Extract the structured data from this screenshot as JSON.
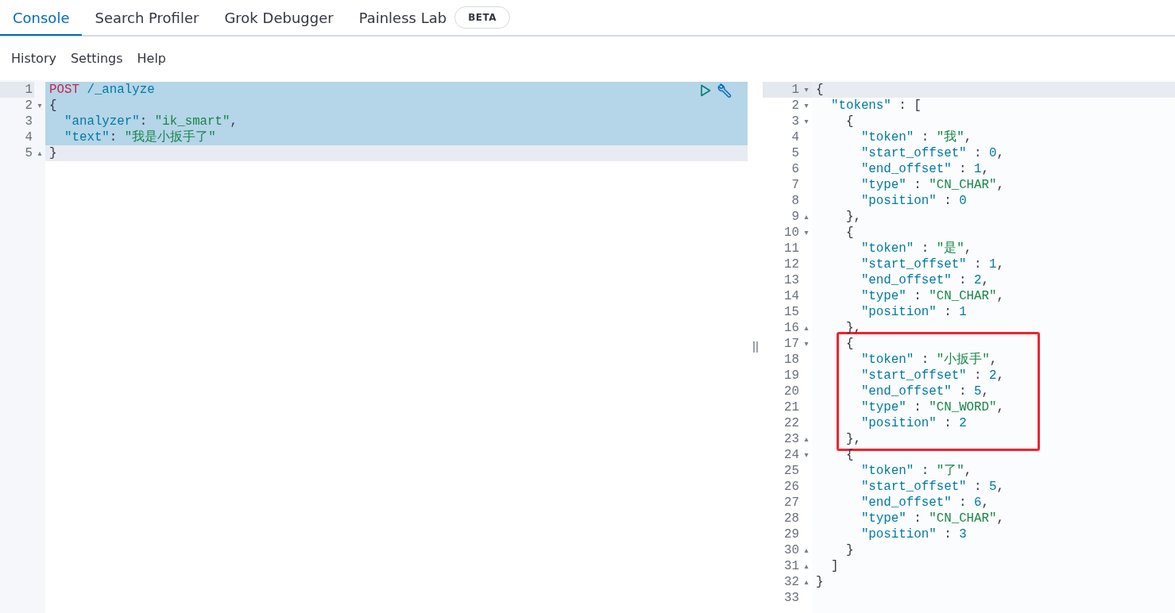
{
  "tabs": [
    {
      "label": "Console",
      "selected": true
    },
    {
      "label": "Search Profiler",
      "selected": false
    },
    {
      "label": "Grok Debugger",
      "selected": false
    },
    {
      "label": "Painless Lab",
      "selected": false,
      "badge": "BETA"
    }
  ],
  "menu": [
    "History",
    "Settings",
    "Help"
  ],
  "request": {
    "lines": [
      {
        "number": "1",
        "selected": true,
        "current": false,
        "gutter_highlight": true,
        "tokens": [
          {
            "kind": "method",
            "text": "POST"
          },
          {
            "kind": "url",
            "text": " /_analyze"
          }
        ]
      },
      {
        "number": "2",
        "fold": "▾",
        "selected": true,
        "current": false,
        "gutter_highlight": false,
        "tokens": [
          {
            "kind": "punct",
            "text": "{"
          }
        ]
      },
      {
        "number": "3",
        "selected": true,
        "current": false,
        "gutter_highlight": false,
        "tokens": [
          {
            "kind": "key",
            "text": "  \"analyzer\""
          },
          {
            "kind": "punct",
            "text": ": "
          },
          {
            "kind": "string",
            "text": "\"ik_smart\""
          },
          {
            "kind": "punct",
            "text": ","
          }
        ]
      },
      {
        "number": "4",
        "selected": true,
        "current": false,
        "gutter_highlight": false,
        "tokens": [
          {
            "kind": "key",
            "text": "  \"text\""
          },
          {
            "kind": "punct",
            "text": ": "
          },
          {
            "kind": "string",
            "text": "\"我是小扳手了\""
          }
        ]
      },
      {
        "number": "5",
        "fold": "▴",
        "selected": false,
        "current": true,
        "gutter_highlight": false,
        "tokens": [
          {
            "kind": "punct",
            "text": "}"
          }
        ]
      }
    ]
  },
  "response": {
    "lines": [
      {
        "number": "1",
        "fold": "▾",
        "current": true,
        "gutter_highlight": true,
        "boxed": false,
        "tokens": [
          {
            "kind": "punct",
            "text": "{"
          }
        ]
      },
      {
        "number": "2",
        "fold": "▾",
        "current": false,
        "gutter_highlight": false,
        "boxed": false,
        "tokens": [
          {
            "kind": "key",
            "text": "  \"tokens\""
          },
          {
            "kind": "punct",
            "text": " : ["
          }
        ]
      },
      {
        "number": "3",
        "fold": "▾",
        "current": false,
        "gutter_highlight": false,
        "boxed": false,
        "tokens": [
          {
            "kind": "punct",
            "text": "    {"
          }
        ]
      },
      {
        "number": "4",
        "current": false,
        "gutter_highlight": false,
        "boxed": false,
        "tokens": [
          {
            "kind": "key",
            "text": "      \"token\""
          },
          {
            "kind": "punct",
            "text": " : "
          },
          {
            "kind": "string",
            "text": "\"我\""
          },
          {
            "kind": "punct",
            "text": ","
          }
        ]
      },
      {
        "number": "5",
        "current": false,
        "gutter_highlight": false,
        "boxed": false,
        "tokens": [
          {
            "kind": "key",
            "text": "      \"start_offset\""
          },
          {
            "kind": "punct",
            "text": " : "
          },
          {
            "kind": "number",
            "text": "0"
          },
          {
            "kind": "punct",
            "text": ","
          }
        ]
      },
      {
        "number": "6",
        "current": false,
        "gutter_highlight": false,
        "boxed": false,
        "tokens": [
          {
            "kind": "key",
            "text": "      \"end_offset\""
          },
          {
            "kind": "punct",
            "text": " : "
          },
          {
            "kind": "number",
            "text": "1"
          },
          {
            "kind": "punct",
            "text": ","
          }
        ]
      },
      {
        "number": "7",
        "current": false,
        "gutter_highlight": false,
        "boxed": false,
        "tokens": [
          {
            "kind": "key",
            "text": "      \"type\""
          },
          {
            "kind": "punct",
            "text": " : "
          },
          {
            "kind": "string",
            "text": "\"CN_CHAR\""
          },
          {
            "kind": "punct",
            "text": ","
          }
        ]
      },
      {
        "number": "8",
        "current": false,
        "gutter_highlight": false,
        "boxed": false,
        "tokens": [
          {
            "kind": "key",
            "text": "      \"position\""
          },
          {
            "kind": "punct",
            "text": " : "
          },
          {
            "kind": "number",
            "text": "0"
          }
        ]
      },
      {
        "number": "9",
        "fold": "▴",
        "current": false,
        "gutter_highlight": false,
        "boxed": false,
        "tokens": [
          {
            "kind": "punct",
            "text": "    },"
          }
        ]
      },
      {
        "number": "10",
        "fold": "▾",
        "current": false,
        "gutter_highlight": false,
        "boxed": false,
        "tokens": [
          {
            "kind": "punct",
            "text": "    {"
          }
        ]
      },
      {
        "number": "11",
        "current": false,
        "gutter_highlight": false,
        "boxed": false,
        "tokens": [
          {
            "kind": "key",
            "text": "      \"token\""
          },
          {
            "kind": "punct",
            "text": " : "
          },
          {
            "kind": "string",
            "text": "\"是\""
          },
          {
            "kind": "punct",
            "text": ","
          }
        ]
      },
      {
        "number": "12",
        "current": false,
        "gutter_highlight": false,
        "boxed": false,
        "tokens": [
          {
            "kind": "key",
            "text": "      \"start_offset\""
          },
          {
            "kind": "punct",
            "text": " : "
          },
          {
            "kind": "number",
            "text": "1"
          },
          {
            "kind": "punct",
            "text": ","
          }
        ]
      },
      {
        "number": "13",
        "current": false,
        "gutter_highlight": false,
        "boxed": false,
        "tokens": [
          {
            "kind": "key",
            "text": "      \"end_offset\""
          },
          {
            "kind": "punct",
            "text": " : "
          },
          {
            "kind": "number",
            "text": "2"
          },
          {
            "kind": "punct",
            "text": ","
          }
        ]
      },
      {
        "number": "14",
        "current": false,
        "gutter_highlight": false,
        "boxed": false,
        "tokens": [
          {
            "kind": "key",
            "text": "      \"type\""
          },
          {
            "kind": "punct",
            "text": " : "
          },
          {
            "kind": "string",
            "text": "\"CN_CHAR\""
          },
          {
            "kind": "punct",
            "text": ","
          }
        ]
      },
      {
        "number": "15",
        "current": false,
        "gutter_highlight": false,
        "boxed": false,
        "tokens": [
          {
            "kind": "key",
            "text": "      \"position\""
          },
          {
            "kind": "punct",
            "text": " : "
          },
          {
            "kind": "number",
            "text": "1"
          }
        ]
      },
      {
        "number": "16",
        "fold": "▴",
        "current": false,
        "gutter_highlight": false,
        "boxed": false,
        "tokens": [
          {
            "kind": "punct",
            "text": "    },"
          }
        ]
      },
      {
        "number": "17",
        "fold": "▾",
        "current": false,
        "gutter_highlight": false,
        "boxed": true,
        "tokens": [
          {
            "kind": "punct",
            "text": "    {"
          }
        ]
      },
      {
        "number": "18",
        "current": false,
        "gutter_highlight": false,
        "boxed": true,
        "tokens": [
          {
            "kind": "key",
            "text": "      \"token\""
          },
          {
            "kind": "punct",
            "text": " : "
          },
          {
            "kind": "string",
            "text": "\"小扳手\""
          },
          {
            "kind": "punct",
            "text": ","
          }
        ]
      },
      {
        "number": "19",
        "current": false,
        "gutter_highlight": false,
        "boxed": true,
        "tokens": [
          {
            "kind": "key",
            "text": "      \"start_offset\""
          },
          {
            "kind": "punct",
            "text": " : "
          },
          {
            "kind": "number",
            "text": "2"
          },
          {
            "kind": "punct",
            "text": ","
          }
        ]
      },
      {
        "number": "20",
        "current": false,
        "gutter_highlight": false,
        "boxed": true,
        "tokens": [
          {
            "kind": "key",
            "text": "      \"end_offset\""
          },
          {
            "kind": "punct",
            "text": " : "
          },
          {
            "kind": "number",
            "text": "5"
          },
          {
            "kind": "punct",
            "text": ","
          }
        ]
      },
      {
        "number": "21",
        "current": false,
        "gutter_highlight": false,
        "boxed": true,
        "tokens": [
          {
            "kind": "key",
            "text": "      \"type\""
          },
          {
            "kind": "punct",
            "text": " : "
          },
          {
            "kind": "string",
            "text": "\"CN_WORD\""
          },
          {
            "kind": "punct",
            "text": ","
          }
        ]
      },
      {
        "number": "22",
        "current": false,
        "gutter_highlight": false,
        "boxed": true,
        "tokens": [
          {
            "kind": "key",
            "text": "      \"position\""
          },
          {
            "kind": "punct",
            "text": " : "
          },
          {
            "kind": "number",
            "text": "2"
          }
        ]
      },
      {
        "number": "23",
        "fold": "▴",
        "current": false,
        "gutter_highlight": false,
        "boxed": true,
        "tokens": [
          {
            "kind": "punct",
            "text": "    },"
          }
        ]
      },
      {
        "number": "24",
        "fold": "▾",
        "current": false,
        "gutter_highlight": false,
        "boxed": false,
        "tokens": [
          {
            "kind": "punct",
            "text": "    {"
          }
        ]
      },
      {
        "number": "25",
        "current": false,
        "gutter_highlight": false,
        "boxed": false,
        "tokens": [
          {
            "kind": "key",
            "text": "      \"token\""
          },
          {
            "kind": "punct",
            "text": " : "
          },
          {
            "kind": "string",
            "text": "\"了\""
          },
          {
            "kind": "punct",
            "text": ","
          }
        ]
      },
      {
        "number": "26",
        "current": false,
        "gutter_highlight": false,
        "boxed": false,
        "tokens": [
          {
            "kind": "key",
            "text": "      \"start_offset\""
          },
          {
            "kind": "punct",
            "text": " : "
          },
          {
            "kind": "number",
            "text": "5"
          },
          {
            "kind": "punct",
            "text": ","
          }
        ]
      },
      {
        "number": "27",
        "current": false,
        "gutter_highlight": false,
        "boxed": false,
        "tokens": [
          {
            "kind": "key",
            "text": "      \"end_offset\""
          },
          {
            "kind": "punct",
            "text": " : "
          },
          {
            "kind": "number",
            "text": "6"
          },
          {
            "kind": "punct",
            "text": ","
          }
        ]
      },
      {
        "number": "28",
        "current": false,
        "gutter_highlight": false,
        "boxed": false,
        "tokens": [
          {
            "kind": "key",
            "text": "      \"type\""
          },
          {
            "kind": "punct",
            "text": " : "
          },
          {
            "kind": "string",
            "text": "\"CN_CHAR\""
          },
          {
            "kind": "punct",
            "text": ","
          }
        ]
      },
      {
        "number": "29",
        "current": false,
        "gutter_highlight": false,
        "boxed": false,
        "tokens": [
          {
            "kind": "key",
            "text": "      \"position\""
          },
          {
            "kind": "punct",
            "text": " : "
          },
          {
            "kind": "number",
            "text": "3"
          }
        ]
      },
      {
        "number": "30",
        "fold": "▴",
        "current": false,
        "gutter_highlight": false,
        "boxed": false,
        "tokens": [
          {
            "kind": "punct",
            "text": "    }"
          }
        ]
      },
      {
        "number": "31",
        "fold": "▴",
        "current": false,
        "gutter_highlight": false,
        "boxed": false,
        "tokens": [
          {
            "kind": "punct",
            "text": "  ]"
          }
        ]
      },
      {
        "number": "32",
        "fold": "▴",
        "current": false,
        "gutter_highlight": false,
        "boxed": false,
        "tokens": [
          {
            "kind": "punct",
            "text": "}"
          }
        ]
      },
      {
        "number": "33",
        "gutter_highlight": false
      }
    ]
  }
}
